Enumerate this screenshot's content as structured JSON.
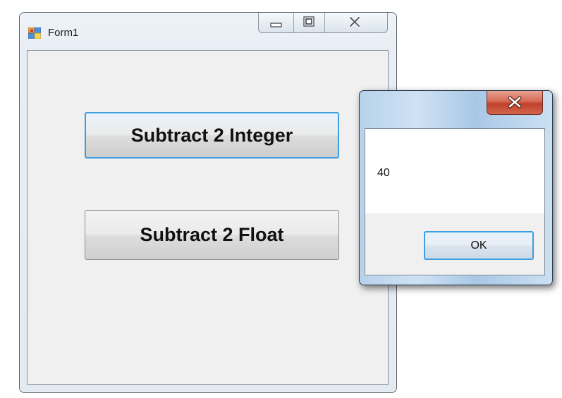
{
  "form": {
    "title": "Form1",
    "buttons": {
      "subtract_int": "Subtract 2 Integer",
      "subtract_float": "Subtract 2 Float"
    }
  },
  "messagebox": {
    "text": "40",
    "ok_label": "OK"
  }
}
